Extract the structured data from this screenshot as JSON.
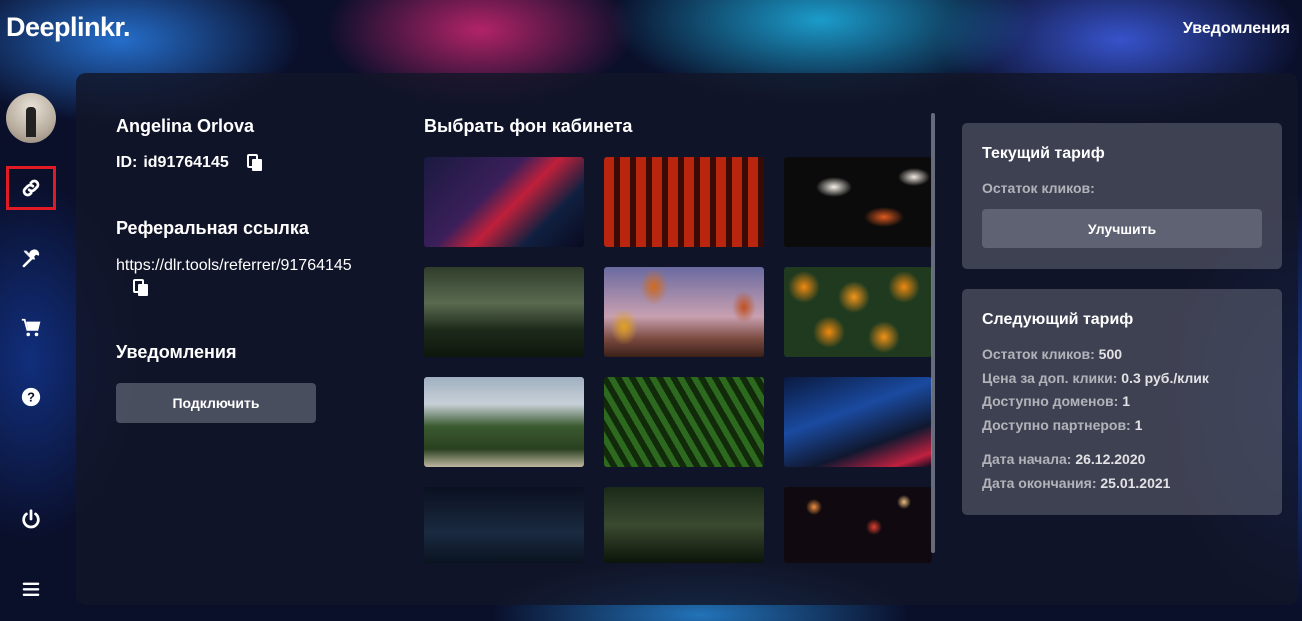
{
  "app": {
    "logo": "Deeplinkr.",
    "top_notifications": "Уведомления"
  },
  "sidebar": {
    "items": [
      {
        "icon": "link-icon",
        "active": true
      },
      {
        "icon": "tools-icon"
      },
      {
        "icon": "cart-icon"
      },
      {
        "icon": "help-icon"
      },
      {
        "icon": "power-icon"
      },
      {
        "icon": "menu-icon"
      }
    ]
  },
  "profile": {
    "name": "Angelina Orlova",
    "id_label": "ID:",
    "id_value": "id91764145",
    "referral_title": "Реферальная ссылка",
    "referral_link": "https://dlr.tools/referrer/91764145",
    "notifications_title": "Уведомления",
    "connect_button": "Подключить"
  },
  "backgrounds": {
    "title": "Выбрать фон кабинета",
    "thumbnails": [
      "neon-street",
      "torii-gates",
      "koi-fish",
      "temple-garden",
      "hot-air-balloons",
      "oranges",
      "palm-beach",
      "fern-leaves",
      "city-night",
      "night-lake",
      "forest-bridge",
      "bokeh-lights"
    ]
  },
  "current_plan": {
    "title": "Текущий тариф",
    "clicks_left": "Остаток кликов:",
    "upgrade_button": "Улучшить"
  },
  "next_plan": {
    "title": "Следующий тариф",
    "lines": [
      {
        "label": "Остаток кликов:",
        "value": "500"
      },
      {
        "label": "Цена за доп. клики:",
        "value": "0.3 руб./клик"
      },
      {
        "label": "Доступно доменов:",
        "value": "1"
      },
      {
        "label": "Доступно партнеров:",
        "value": "1"
      },
      {
        "label": "Дата начала:",
        "value": "26.12.2020"
      },
      {
        "label": "Дата окончания:",
        "value": "25.01.2021"
      }
    ]
  }
}
